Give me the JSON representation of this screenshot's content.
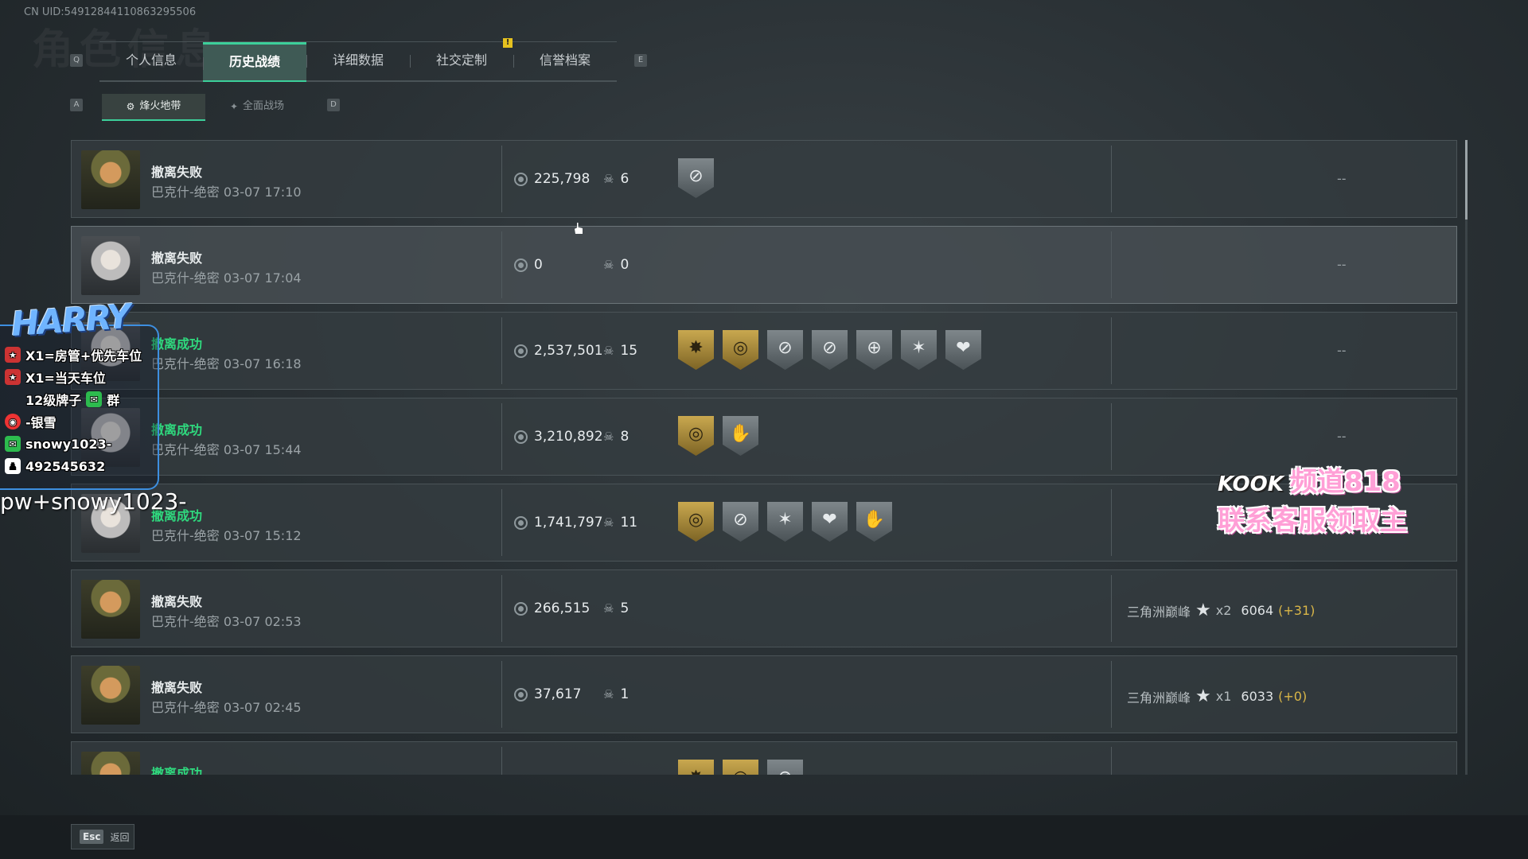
{
  "uid": "CN UID:54912844110863295506",
  "bg_title": "角色信息",
  "tabs": [
    {
      "label": "个人信息"
    },
    {
      "label": "历史战绩"
    },
    {
      "label": "详细数据"
    },
    {
      "label": "社交定制"
    },
    {
      "label": "信誉档案"
    }
  ],
  "keys": {
    "prev": "Q",
    "next": "E",
    "sub_prev": "A",
    "sub_next": "D",
    "notif": "!"
  },
  "subtabs": [
    {
      "label": "烽火地带"
    },
    {
      "label": "全面战场"
    }
  ],
  "records": [
    {
      "status": "撤离失败",
      "outcome": "fail",
      "avatar": "soldier",
      "meta": "巴克什-绝密 03-07 17:10",
      "value": "225,798",
      "kills": "6",
      "badges": [
        "silver:target-off"
      ],
      "rank": "",
      "stars": "",
      "points": "",
      "delta": "",
      "dash": "--"
    },
    {
      "status": "撤离失败",
      "outcome": "fail",
      "avatar": "girl",
      "meta": "巴克什-绝密 03-07 17:04",
      "value": "0",
      "kills": "0",
      "badges": [],
      "rank": "",
      "stars": "",
      "points": "",
      "delta": "",
      "dash": "--"
    },
    {
      "status": "撤离成功",
      "outcome": "succ",
      "avatar": "girl",
      "meta": "巴克什-绝密 03-07 16:18",
      "value": "2,537,501",
      "kills": "15",
      "badges": [
        "gold:burst",
        "gold:target",
        "silver:target-off",
        "silver:target-off",
        "silver:crosshair",
        "silver:star",
        "silver:heart"
      ],
      "rank": "",
      "stars": "",
      "points": "",
      "delta": "",
      "dash": "--"
    },
    {
      "status": "撤离成功",
      "outcome": "succ",
      "avatar": "girl",
      "meta": "巴克什-绝密 03-07 15:44",
      "value": "3,210,892",
      "kills": "8",
      "badges": [
        "gold:target",
        "silver:hand"
      ],
      "rank": "",
      "stars": "",
      "points": "",
      "delta": "",
      "dash": "--"
    },
    {
      "status": "撤离成功",
      "outcome": "succ",
      "avatar": "girl",
      "meta": "巴克什-绝密 03-07 15:12",
      "value": "1,741,797",
      "kills": "11",
      "badges": [
        "gold:target",
        "silver:target-off",
        "silver:star",
        "silver:heart",
        "silver:hand"
      ],
      "rank": "",
      "stars": "",
      "points": "",
      "delta": "",
      "dash": "--"
    },
    {
      "status": "撤离失败",
      "outcome": "fail",
      "avatar": "soldier",
      "meta": "巴克什-绝密 03-07 02:53",
      "value": "266,515",
      "kills": "5",
      "badges": [],
      "rank": "三角洲巅峰",
      "stars": "x2",
      "points": "6064",
      "delta": "(+31)",
      "dash": ""
    },
    {
      "status": "撤离失败",
      "outcome": "fail",
      "avatar": "soldier",
      "meta": "巴克什-绝密 03-07 02:45",
      "value": "37,617",
      "kills": "1",
      "badges": [],
      "rank": "三角洲巅峰",
      "stars": "x1",
      "points": "6033",
      "delta": "(+0)",
      "dash": ""
    },
    {
      "status": "撤离成功",
      "outcome": "succ",
      "avatar": "soldier",
      "meta": "",
      "value": "",
      "kills": "",
      "badges": [
        "gold:burst",
        "gold:target",
        "silver:target-off"
      ],
      "rank": "",
      "stars": "",
      "points": "",
      "delta": "",
      "dash": ""
    }
  ],
  "hover_index": 1,
  "footer": {
    "esc_key": "Esc",
    "back_label": "返回"
  },
  "overlay": {
    "logo": "HARRY",
    "lines": [
      {
        "icon": "fan-icon",
        "text": "X1=房管+优先车位"
      },
      {
        "icon": "fan-icon",
        "text": "X1=当天车位"
      },
      {
        "icon": "",
        "text": "12级牌子"
      },
      {
        "icon": "weibo-icon",
        "text": "-银雪"
      },
      {
        "icon": "wechat-icon",
        "text": "snowy1023-"
      },
      {
        "icon": "qq-icon",
        "text": "492545632"
      }
    ],
    "wechat_suffix": "群",
    "subtitle": "pw+snowy1023-",
    "kook_brand": "KOOK",
    "kook_line1": "频道818",
    "kook_line2": "联系客服领取主"
  },
  "colors": {
    "accent": "#3ccf9a",
    "success": "#2fd97e",
    "delta": "#d9b648"
  }
}
